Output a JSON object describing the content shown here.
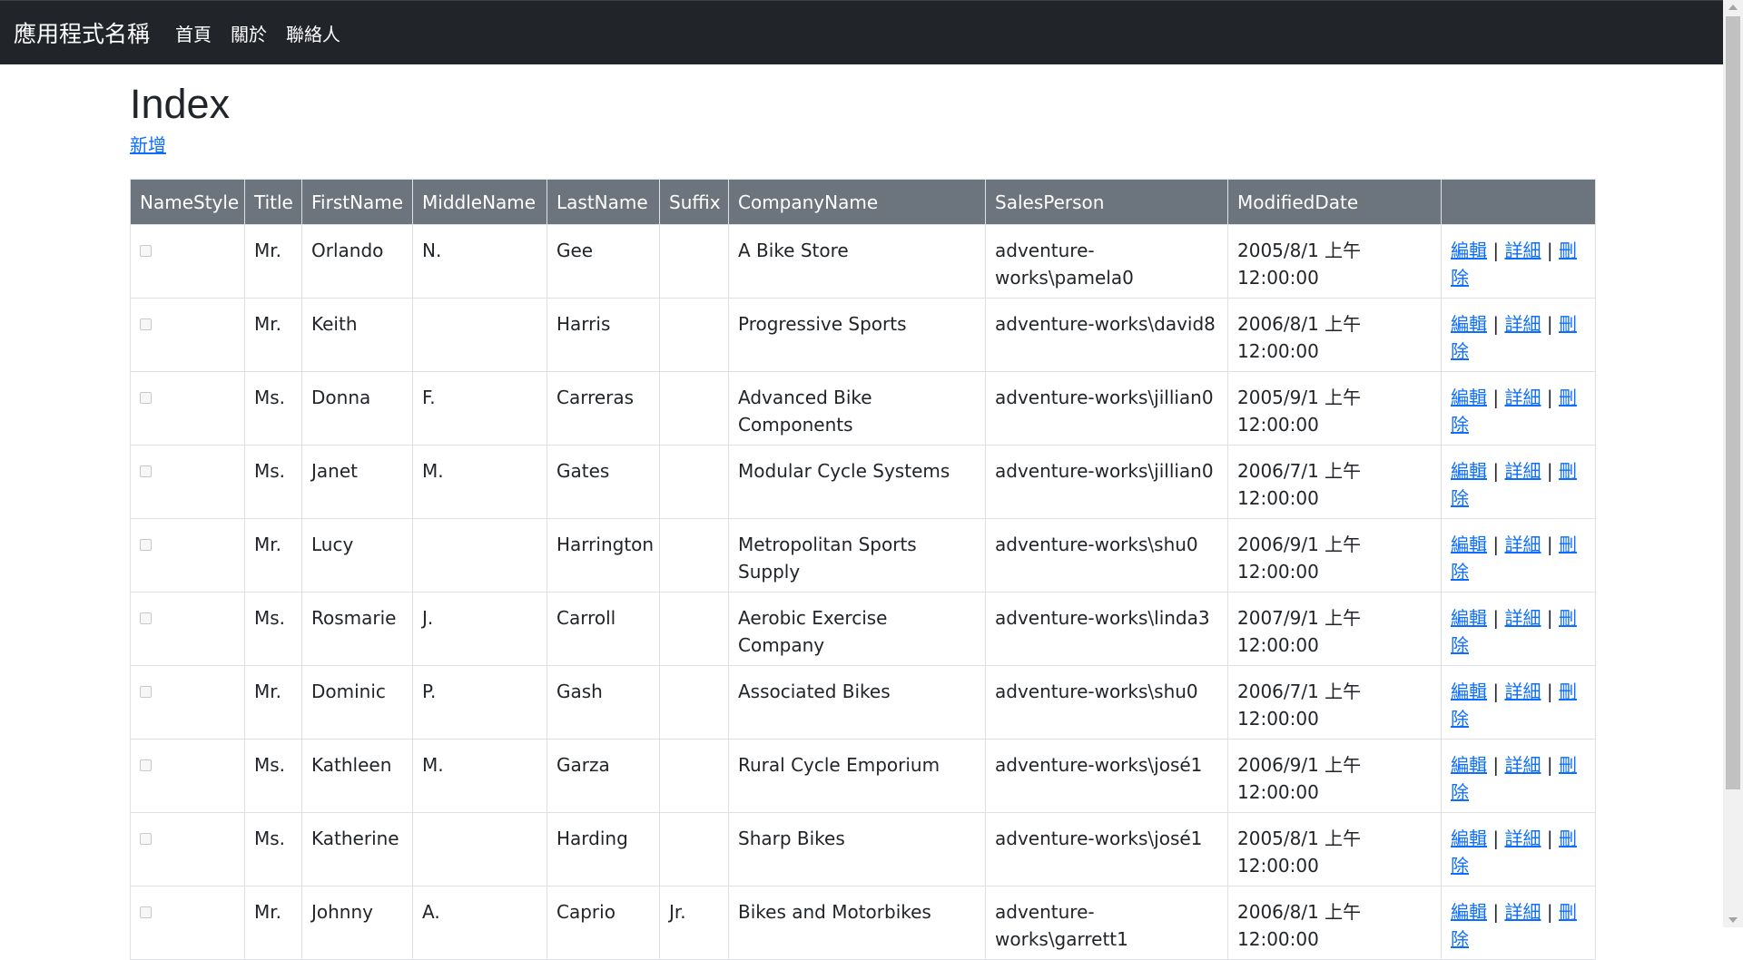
{
  "navbar": {
    "brand": "應用程式名稱",
    "links": [
      "首頁",
      "關於",
      "聯絡人"
    ],
    "background": "#212529"
  },
  "page": {
    "title": "Index",
    "create_link": "新增"
  },
  "table": {
    "header_color": "#6c757d",
    "columns": [
      "NameStyle",
      "Title",
      "FirstName",
      "MiddleName",
      "LastName",
      "Suffix",
      "CompanyName",
      "SalesPerson",
      "ModifiedDate",
      ""
    ],
    "actions": {
      "edit": "編輯",
      "details": "詳細",
      "delete": "刪除",
      "separator": "|",
      "link_color": "#0d6efd"
    },
    "rows": [
      {
        "name_style": false,
        "title": "Mr.",
        "first_name": "Orlando",
        "middle_name": "N.",
        "last_name": "Gee",
        "suffix": "",
        "company": "A Bike Store",
        "sales_person": "adventure-works\\pamela0",
        "modified_date": "2005/8/1 上午 12:00:00"
      },
      {
        "name_style": false,
        "title": "Mr.",
        "first_name": "Keith",
        "middle_name": "",
        "last_name": "Harris",
        "suffix": "",
        "company": "Progressive Sports",
        "sales_person": "adventure-works\\david8",
        "modified_date": "2006/8/1 上午 12:00:00"
      },
      {
        "name_style": false,
        "title": "Ms.",
        "first_name": "Donna",
        "middle_name": "F.",
        "last_name": "Carreras",
        "suffix": "",
        "company": "Advanced Bike Components",
        "sales_person": "adventure-works\\jillian0",
        "modified_date": "2005/9/1 上午 12:00:00"
      },
      {
        "name_style": false,
        "title": "Ms.",
        "first_name": "Janet",
        "middle_name": "M.",
        "last_name": "Gates",
        "suffix": "",
        "company": "Modular Cycle Systems",
        "sales_person": "adventure-works\\jillian0",
        "modified_date": "2006/7/1 上午 12:00:00"
      },
      {
        "name_style": false,
        "title": "Mr.",
        "first_name": "Lucy",
        "middle_name": "",
        "last_name": "Harrington",
        "suffix": "",
        "company": "Metropolitan Sports Supply",
        "sales_person": "adventure-works\\shu0",
        "modified_date": "2006/9/1 上午 12:00:00"
      },
      {
        "name_style": false,
        "title": "Ms.",
        "first_name": "Rosmarie",
        "middle_name": "J.",
        "last_name": "Carroll",
        "suffix": "",
        "company": "Aerobic Exercise Company",
        "sales_person": "adventure-works\\linda3",
        "modified_date": "2007/9/1 上午 12:00:00"
      },
      {
        "name_style": false,
        "title": "Mr.",
        "first_name": "Dominic",
        "middle_name": "P.",
        "last_name": "Gash",
        "suffix": "",
        "company": "Associated Bikes",
        "sales_person": "adventure-works\\shu0",
        "modified_date": "2006/7/1 上午 12:00:00"
      },
      {
        "name_style": false,
        "title": "Ms.",
        "first_name": "Kathleen",
        "middle_name": "M.",
        "last_name": "Garza",
        "suffix": "",
        "company": "Rural Cycle Emporium",
        "sales_person": "adventure-works\\josé1",
        "modified_date": "2006/9/1 上午 12:00:00"
      },
      {
        "name_style": false,
        "title": "Ms.",
        "first_name": "Katherine",
        "middle_name": "",
        "last_name": "Harding",
        "suffix": "",
        "company": "Sharp Bikes",
        "sales_person": "adventure-works\\josé1",
        "modified_date": "2005/8/1 上午 12:00:00"
      },
      {
        "name_style": false,
        "title": "Mr.",
        "first_name": "Johnny",
        "middle_name": "A.",
        "last_name": "Caprio",
        "suffix": "Jr.",
        "company": "Bikes and Motorbikes",
        "sales_person": "adventure-works\\garrett1",
        "modified_date": "2006/8/1 上午 12:00:00"
      }
    ]
  }
}
